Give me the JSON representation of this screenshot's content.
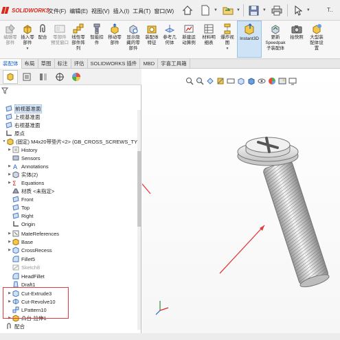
{
  "app": {
    "logo_text": "SOLIDWORKS"
  },
  "menu": [
    "文件(F)",
    "编辑(E)",
    "视图(V)",
    "插入(I)",
    "工具(T)",
    "窗口(W)"
  ],
  "toolbar_more": "T..",
  "ribbon": {
    "buttons": [
      {
        "label": "编辑零\n部件",
        "disabled": true
      },
      {
        "label": "插入零\n部件",
        "disabled": false
      },
      {
        "label": "配合",
        "disabled": false
      },
      {
        "label": "零部件\n预览窗口",
        "disabled": true
      },
      {
        "label": "线性零\n部件阵\n列",
        "disabled": false
      },
      {
        "label": "智能扣\n件",
        "disabled": false
      },
      {
        "label": "移动零\n部件",
        "disabled": false
      },
      {
        "label": "显示隐\n藏的零\n部件",
        "disabled": false
      },
      {
        "label": "装配体\n特征",
        "disabled": false
      },
      {
        "label": "参考几\n何体",
        "disabled": false
      },
      {
        "label": "新建运\n动算例",
        "disabled": false
      },
      {
        "label": "材料明\n细表",
        "disabled": false
      },
      {
        "label": "爆炸视\n图",
        "disabled": false
      },
      {
        "label": "Instant3D",
        "disabled": false
      },
      {
        "label": "更新\nSpeedpak\n子装配体",
        "disabled": false
      },
      {
        "label": "拍快照",
        "disabled": false
      },
      {
        "label": "大型装\n配体设\n置",
        "disabled": false
      }
    ]
  },
  "tabs": [
    {
      "label": "装配体",
      "active": true
    },
    {
      "label": "布局",
      "active": false
    },
    {
      "label": "草图",
      "active": false
    },
    {
      "label": "标注",
      "active": false
    },
    {
      "label": "评估",
      "active": false
    },
    {
      "label": "SOLIDWORKS 插件",
      "active": false
    },
    {
      "label": "MBD",
      "active": false
    },
    {
      "label": "宇喜工具箱",
      "active": false
    }
  ],
  "tree": {
    "planes": [
      "前视基准面",
      "上视基准面",
      "右视基准面"
    ],
    "origin": "原点",
    "component": "(固定) M4x20带垫片<2> (GB_CROSS_SCREWS_TY",
    "features": [
      {
        "label": "History",
        "grey": false
      },
      {
        "label": "Sensors",
        "grey": false
      },
      {
        "label": "Annotations",
        "grey": false
      },
      {
        "label": "实体(2)",
        "grey": false
      },
      {
        "label": "Equations",
        "grey": false
      },
      {
        "label": "材质 <未指定>",
        "grey": false
      },
      {
        "label": "Front",
        "grey": false
      },
      {
        "label": "Top",
        "grey": false
      },
      {
        "label": "Right",
        "grey": false
      },
      {
        "label": "Origin",
        "grey": false
      },
      {
        "label": "MateReferences",
        "grey": false
      },
      {
        "label": "Base",
        "grey": false
      },
      {
        "label": "CrossRecess",
        "grey": false
      },
      {
        "label": "Fillet5",
        "grey": false
      },
      {
        "label": "Sketch8",
        "grey": true
      },
      {
        "label": "HeadFillet",
        "grey": false
      },
      {
        "label": "Draft1",
        "grey": false
      },
      {
        "label": "Cut-Extrude3",
        "grey": false
      },
      {
        "label": "Cut-Revolve10",
        "grey": false
      },
      {
        "label": "LPattern10",
        "grey": false
      },
      {
        "label": "凸台-拉伸1",
        "grey": false
      }
    ],
    "mates": "配合"
  },
  "colors": {
    "accent": "#1c64c8",
    "annotation_red": "#e23b3b",
    "logo_red": "#d9281c"
  }
}
